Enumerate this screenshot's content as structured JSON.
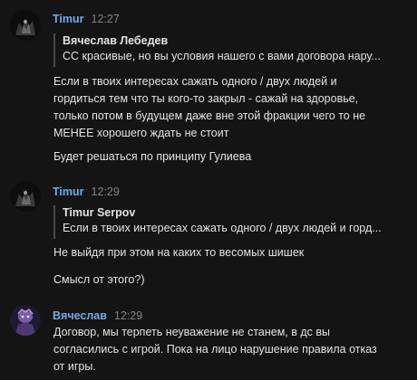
{
  "messages": [
    {
      "author": "Timur",
      "time": "12:27",
      "avatar_icon": "dark-figure-avatar-icon",
      "reply": {
        "author": "Вячеслав Лебедев",
        "text": "СС красивые, но вы условия нашего с вами договора нару..."
      },
      "paragraphs": [
        [
          "Если в твоих интересах сажать одного / двух людей и",
          "гордиться тем что ты кого-то закрыл - сажай на здоровье,",
          "только потом в будущем даже вне этой фракции чего то не",
          "МЕНЕЕ хорошего ждать не стоит"
        ],
        [
          "Будет решаться по принципу Гулиева"
        ]
      ]
    },
    {
      "author": "Timur",
      "time": "12:29",
      "avatar_icon": "dark-figure-avatar-icon",
      "reply": {
        "author": "Timur Serpov",
        "text": "Если в твоих интересах сажать одного / двух людей и горд..."
      },
      "paragraphs": [
        [
          "Не выйдя при этом на каких то весомых шишек"
        ],
        [
          "Смысл от этого?)"
        ]
      ]
    },
    {
      "author": "Вячеслав",
      "time": "12:29",
      "avatar_icon": "purple-character-avatar-icon",
      "paragraphs": [
        [
          "Договор, мы терпеть неуважение не станем, в дс вы",
          "согласились с игрой. Пока на лицо нарушение правила отказ",
          "от игры."
        ]
      ]
    }
  ],
  "colors": {
    "background": "#141414",
    "author": "#71aaeb",
    "text": "#e1e3e6",
    "time": "#828282",
    "reply_bar": "#4a4a4a"
  }
}
